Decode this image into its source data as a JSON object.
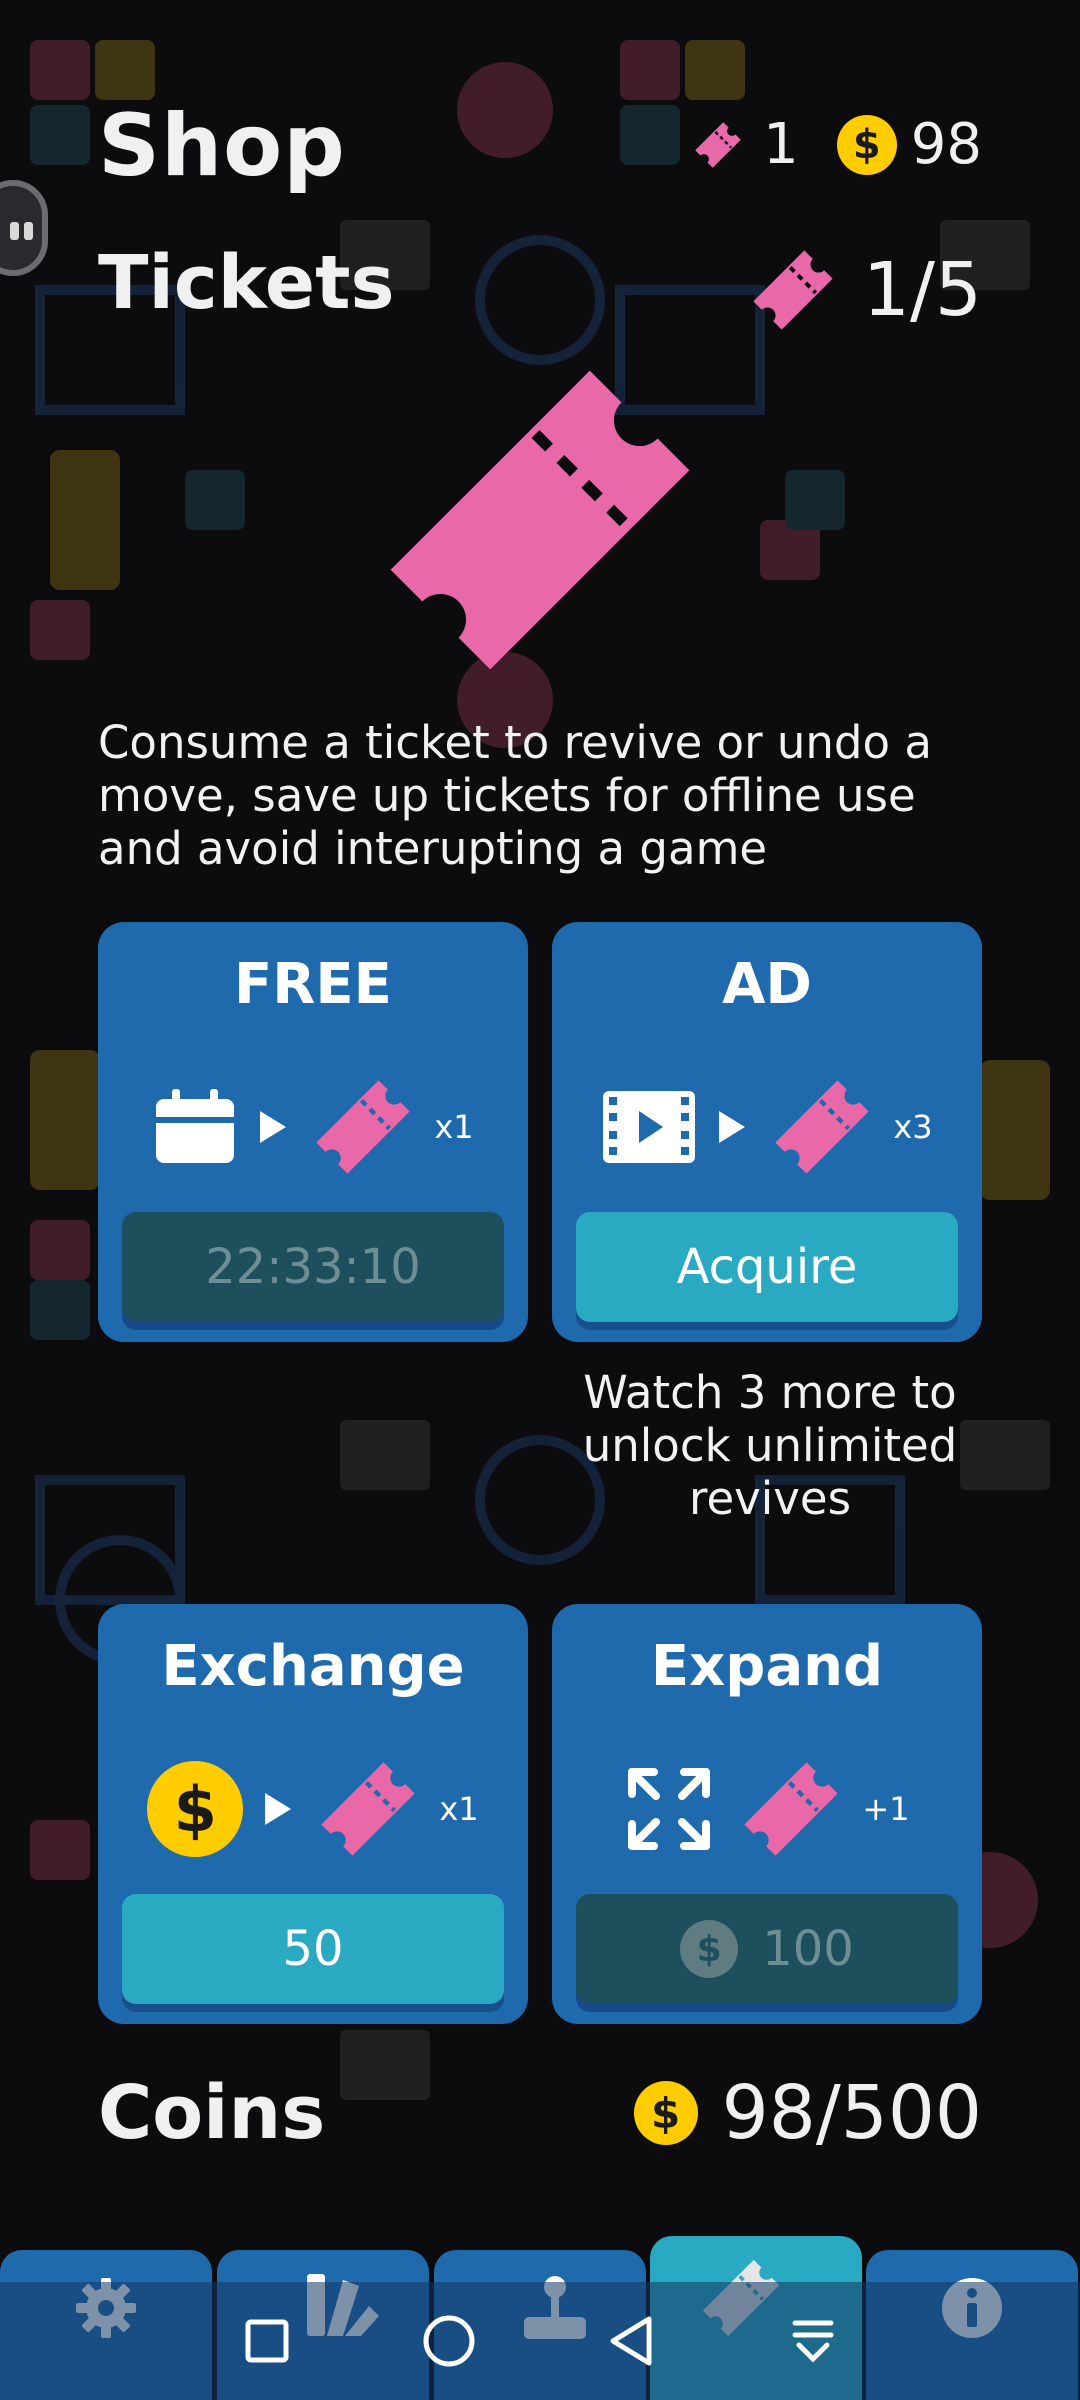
{
  "header": {
    "title": "Shop",
    "ticket_balance": "1",
    "coin_symbol": "$",
    "coin_balance": "98"
  },
  "tickets_section": {
    "title": "Tickets",
    "count": "1/5",
    "description": "Consume a ticket to revive or undo a move, save up tickets for offline use and avoid interupting a game"
  },
  "cards": {
    "free": {
      "title": "FREE",
      "multiplier": "x1",
      "button_label": "22:33:10",
      "icon": "calendar-icon"
    },
    "ad": {
      "title": "AD",
      "multiplier": "x3",
      "button_label": "Acquire",
      "icon": "video-icon",
      "note": "Watch 3 more to unlock unlimited revives"
    },
    "exchange": {
      "title": "Exchange",
      "multiplier": "x1",
      "button_label": "50",
      "icon": "coin-icon"
    },
    "expand": {
      "title": "Expand",
      "multiplier": "+1",
      "button_label": "100",
      "coin_symbol": "$",
      "icon": "expand-arrows-icon"
    }
  },
  "coins_section": {
    "title": "Coins",
    "coin_symbol": "$",
    "count": "98/500"
  },
  "tabs": [
    {
      "name": "settings",
      "icon": "gear-icon"
    },
    {
      "name": "themes",
      "icon": "palette-icon"
    },
    {
      "name": "games",
      "icon": "joystick-icon"
    },
    {
      "name": "shop",
      "icon": "ticket-icon",
      "active": true
    },
    {
      "name": "info",
      "icon": "info-icon"
    }
  ],
  "colors": {
    "background": "#0c0c0f",
    "card": "#1f6aad",
    "accent": "#2aa9c2",
    "ticket": "#e868a8",
    "coin": "#ffcc00"
  }
}
